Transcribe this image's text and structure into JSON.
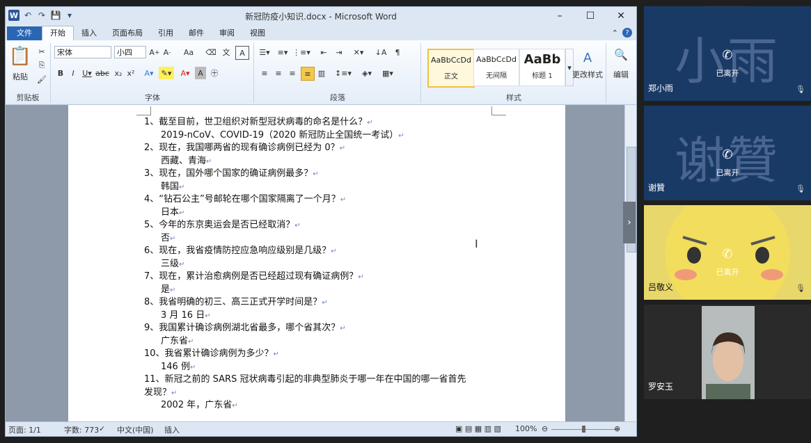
{
  "word": {
    "title": "新冠防疫小知识.docx - Microsoft Word",
    "logo": "W",
    "tabs": [
      "文件",
      "开始",
      "插入",
      "页面布局",
      "引用",
      "邮件",
      "审阅",
      "视图"
    ],
    "ribbon": {
      "clipboard_label": "剪贴板",
      "paste_label": "粘贴",
      "font_label": "字体",
      "paragraph_label": "段落",
      "styles_label": "样式",
      "font_name": "宋体",
      "font_size": "小四",
      "styles": [
        {
          "sample": "AaBbCcDd",
          "name": "正文"
        },
        {
          "sample": "AaBbCcDd",
          "name": "无间隔"
        },
        {
          "sample": "AaBb",
          "name": "标题 1"
        }
      ],
      "change_styles_label": "更改样式",
      "edit_label": "编辑"
    },
    "document": {
      "lines": [
        {
          "q": "1、截至目前，世卫组织对新型冠状病毒的命名是什么？",
          "a": "2019-nCoV、COVID-19（2020 新冠防止全国统一考试）"
        },
        {
          "q": "2、现在，我国哪两省的现有确诊病例已经为 0？",
          "a": "西藏、青海"
        },
        {
          "q": "3、现在，国外哪个国家的确证病例最多？",
          "a": "韩国"
        },
        {
          "q": "4、“钻石公主”号邮轮在哪个国家隔离了一个月？",
          "a": "日本"
        },
        {
          "q": "5、今年的东京奥运会是否已经取消？",
          "a": "否"
        },
        {
          "q": "6、现在，我省疫情防控应急响应级别是几级？",
          "a": "三级"
        },
        {
          "q": "7、现在，累计治愈病例是否已经超过现有确证病例？",
          "a": "是"
        },
        {
          "q": "8、我省明确的初三、高三正式开学时间是？",
          "a": "3 月 16 日"
        },
        {
          "q": "9、我国累计确诊病例湖北省最多，哪个省其次？",
          "a": "广东省"
        },
        {
          "q": "10、我省累计确诊病例为多少？",
          "a": "146 例"
        }
      ],
      "q11_line1": "11、新冠之前的 SARS 冠状病毒引起的非典型肺炎于哪一年在中国的哪一省首先",
      "q11_line2": "发现？",
      "a11": "2002 年，广东省",
      "para_mark": "↵"
    },
    "status": {
      "page": "页面: 1/1",
      "words": "字数: 773",
      "lang": "中文(中国)",
      "mode": "插入",
      "zoom": "100%"
    }
  },
  "participants": [
    {
      "big": "小雨",
      "name": "郑小雨",
      "state": "已离开"
    },
    {
      "big": "谢贊",
      "name": "谢贊",
      "state": "已离开"
    },
    {
      "big": "",
      "name": "吕敬义",
      "state": "已离开"
    },
    {
      "big": "",
      "name": "罗安玉",
      "state": ""
    }
  ]
}
